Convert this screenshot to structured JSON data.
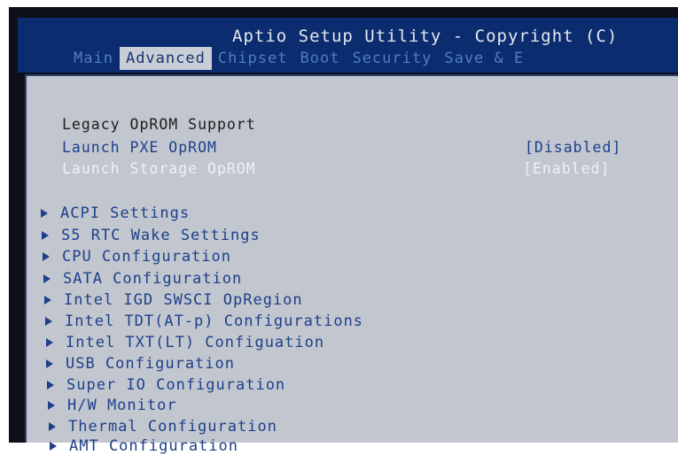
{
  "header": {
    "title": "Aptio Setup Utility - Copyright (C)",
    "tabs": [
      {
        "label": "Main"
      },
      {
        "label": "Advanced"
      },
      {
        "label": "Chipset"
      },
      {
        "label": "Boot"
      },
      {
        "label": "Security"
      },
      {
        "label": "Save & E"
      }
    ],
    "active_tab": "Advanced"
  },
  "content": {
    "section_title": "Legacy OpROM Support",
    "options": [
      {
        "label": "Launch PXE OpROM",
        "value": "[Disabled]"
      },
      {
        "label": "Launch Storage OpROM",
        "value": "[Enabled]"
      }
    ],
    "menu_items": [
      {
        "label": "ACPI Settings"
      },
      {
        "label": "S5 RTC Wake Settings"
      },
      {
        "label": "CPU Configuration"
      },
      {
        "label": "SATA Configuration"
      },
      {
        "label": "Intel IGD SWSCI OpRegion"
      },
      {
        "label": "Intel TDT(AT-p) Configurations"
      },
      {
        "label": "Intel TXT(LT) Configuation"
      },
      {
        "label": "USB Configuration"
      },
      {
        "label": "Super IO Configuration"
      },
      {
        "label": "H/W Monitor"
      },
      {
        "label": "Thermal Configuration"
      },
      {
        "label": "AMT Configuration"
      }
    ]
  },
  "colors": {
    "header_bg": "#0b2c6e",
    "panel_bg": "#c2c7cf",
    "item_blue": "#1e3f8a",
    "tab_inactive": "#4f7ec2",
    "highlight_text": "#eef0f4"
  }
}
